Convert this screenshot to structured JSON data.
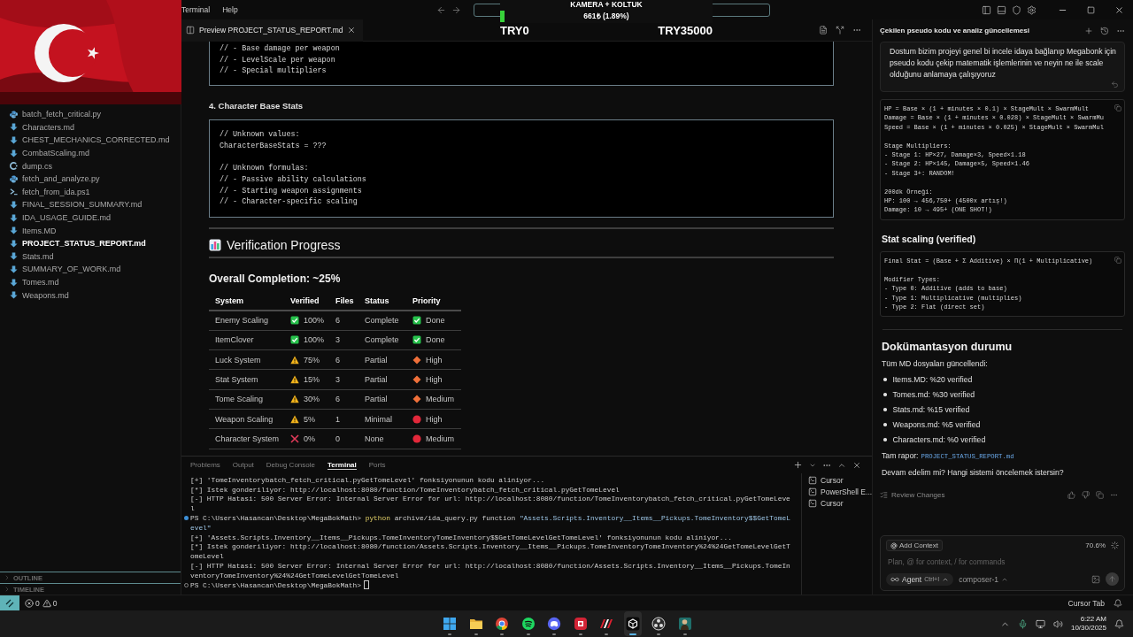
{
  "menu": {
    "items": [
      "Terminal",
      "Help"
    ]
  },
  "overlay": {
    "title": "KAMERA + KOLTUK",
    "reading": "661₺ (1.89%)",
    "level": 0.0189,
    "min_label": "TRY0",
    "max_label": "TRY35000"
  },
  "sidebar": {
    "files": [
      {
        "name": "batch_fetch_critical.py",
        "kind": "python",
        "selected": false
      },
      {
        "name": "Characters.md",
        "kind": "markdown",
        "selected": false
      },
      {
        "name": "CHEST_MECHANICS_CORRECTED.md",
        "kind": "markdown",
        "selected": false
      },
      {
        "name": "CombatScaling.md",
        "kind": "markdown",
        "selected": false
      },
      {
        "name": "dump.cs",
        "kind": "csharp",
        "selected": false
      },
      {
        "name": "fetch_and_analyze.py",
        "kind": "python",
        "selected": false
      },
      {
        "name": "fetch_from_ida.ps1",
        "kind": "powershell",
        "selected": false
      },
      {
        "name": "FINAL_SESSION_SUMMARY.md",
        "kind": "markdown",
        "selected": false
      },
      {
        "name": "IDA_USAGE_GUIDE.md",
        "kind": "markdown",
        "selected": false
      },
      {
        "name": "Items.MD",
        "kind": "markdown",
        "selected": false
      },
      {
        "name": "PROJECT_STATUS_REPORT.md",
        "kind": "markdown",
        "selected": true
      },
      {
        "name": "Stats.md",
        "kind": "markdown",
        "selected": false
      },
      {
        "name": "SUMMARY_OF_WORK.md",
        "kind": "markdown",
        "selected": false
      },
      {
        "name": "Tomes.md",
        "kind": "markdown",
        "selected": false
      },
      {
        "name": "Weapons.md",
        "kind": "markdown",
        "selected": false
      }
    ],
    "sections": [
      "OUTLINE",
      "TIMELINE"
    ]
  },
  "editor": {
    "tab": "Preview PROJECT_STATUS_REPORT.md",
    "code_top": [
      "// - Base damage per weapon",
      "// - LevelScale per weapon",
      "// - Special multipliers"
    ],
    "heading_4": "4. Character Base Stats",
    "code_2": [
      [
        "// Unknown values:",
        "CharacterBaseStats = ???"
      ],
      [
        "// Unknown formulas:",
        "// - Passive ability calculations",
        "// - Starting weapon assignments",
        "// - Character-specific scaling"
      ]
    ],
    "section_title": "Verification Progress",
    "overall": "Overall Completion: ~25%",
    "table": {
      "columns": [
        "System",
        "Verified",
        "Files",
        "Status",
        "Priority"
      ],
      "rows": [
        {
          "system": "Enemy Scaling",
          "verified": {
            "kind": "check",
            "text": "100%"
          },
          "files": "6",
          "status": "Complete",
          "priority": {
            "kind": "check",
            "text": "Done"
          }
        },
        {
          "system": "ItemClover",
          "verified": {
            "kind": "check",
            "text": "100%"
          },
          "files": "3",
          "status": "Complete",
          "priority": {
            "kind": "check",
            "text": "Done"
          }
        },
        {
          "system": "Luck System",
          "verified": {
            "kind": "warning",
            "text": "75%"
          },
          "files": "6",
          "status": "Partial",
          "priority": {
            "kind": "diamond",
            "text": "High"
          }
        },
        {
          "system": "Stat System",
          "verified": {
            "kind": "warning",
            "text": "15%"
          },
          "files": "3",
          "status": "Partial",
          "priority": {
            "kind": "diamond",
            "text": "High"
          }
        },
        {
          "system": "Tome Scaling",
          "verified": {
            "kind": "warning",
            "text": "30%"
          },
          "files": "6",
          "status": "Partial",
          "priority": {
            "kind": "diamond",
            "text": "Medium"
          }
        },
        {
          "system": "Weapon Scaling",
          "verified": {
            "kind": "warning",
            "text": "5%"
          },
          "files": "1",
          "status": "Minimal",
          "priority": {
            "kind": "dot",
            "text": "High"
          }
        },
        {
          "system": "Character System",
          "verified": {
            "kind": "cross",
            "text": "0%"
          },
          "files": "0",
          "status": "None",
          "priority": {
            "kind": "dot",
            "text": "Medium"
          }
        }
      ]
    }
  },
  "terminal": {
    "tabs": [
      {
        "label": "Problems",
        "selected": false
      },
      {
        "label": "Output",
        "selected": false
      },
      {
        "label": "Debug Console",
        "selected": false
      },
      {
        "label": "Terminal",
        "selected": true
      },
      {
        "label": "Ports",
        "selected": false
      }
    ],
    "lines": [
      {
        "kind": "out",
        "text": "[+] 'TomeInventorybatch_fetch_critical.pyGetTomeLevel' fonksiyonunun kodu aliniyor..."
      },
      {
        "kind": "out",
        "text": "[*] Istek gonderiliyor: http://localhost:8080/function/TomeInventorybatch_fetch_critical.pyGetTomeLevel"
      },
      {
        "kind": "out",
        "text": "[-] HTTP Hatasi: 500 Server Error: Internal Server Error for url: http://localhost:8080/function/TomeInventorybatch_fetch_critical.pyGetTomeLeve"
      },
      {
        "kind": "out",
        "text": "l"
      },
      {
        "kind": "prompt",
        "succeeded": true,
        "prompt": "PS C:\\Users\\Hasancan\\Desktop\\MegaBokMath>",
        "command": "python",
        "args": "archive/ida_query.py function",
        "string": "\"Assets.Scripts.Inventory__Items__Pickups.TomeInventory$$GetTomeL"
      },
      {
        "kind": "string",
        "text": "evel\""
      },
      {
        "kind": "out",
        "text": "[+] 'Assets.Scripts.Inventory__Items__Pickups.TomeInventoryTomeInventory$$GetTomeLevelGetTomeLevel' fonksiyonunun kodu aliniyor..."
      },
      {
        "kind": "out",
        "text": "[*] Istek gonderiliyor: http://localhost:8080/function/Assets.Scripts.Inventory__Items__Pickups.TomeInventoryTomeInventory%24%24GetTomeLevelGetT"
      },
      {
        "kind": "out",
        "text": "omeLevel"
      },
      {
        "kind": "out",
        "text": "[-] HTTP Hatasi: 500 Server Error: Internal Server Error for url: http://localhost:8080/function/Assets.Scripts.Inventory__Items__Pickups.TomeIn"
      },
      {
        "kind": "out",
        "text": "ventoryTomeInventory%24%24GetTomeLevelGetTomeLevel"
      },
      {
        "kind": "prompt",
        "succeeded": false,
        "prompt": "PS C:\\Users\\Hasancan\\Desktop\\MegaBokMath>",
        "cursor": true
      }
    ],
    "sessions": [
      "Cursor",
      "PowerShell E...",
      "Cursor"
    ]
  },
  "chat": {
    "title": "Çekilen pseudo kodu ve analiz güncellemesi",
    "message": "Dostum bizim projeyi genel bi incele idaya bağlanıp Megabonk için pseudo kodu çekip matematik işlemlerinin ve neyin ne ile scale olduğunu anlamaya çalışıyoruz",
    "code_1": [
      [
        "HP = Base × (1 + minutes × 0.1) × StageMult × SwarmMult",
        "Damage = Base × (1 + minutes × 0.028) × StageMult × SwarmMu",
        "Speed = Base × (1 + minutes × 0.025) × StageMult × SwarmMul"
      ],
      [
        "Stage Multipliers:",
        "- Stage 1: HP×27, Damage×3, Speed×1.18",
        "- Stage 2: HP×145, Damage×5, Speed×1.46",
        "- Stage 3+: RANDOM!"
      ],
      [
        "200dk Örneği:",
        "HP: 100 → 456,750+ (4500x artış!)",
        "Damage: 10 → 495+ (ONE SHOT!)"
      ]
    ],
    "heading_1": "Stat scaling (verified)",
    "code_2": [
      [
        "Final Stat = (Base + Σ Additive) × Π(1 + Multiplicative)"
      ],
      [
        "Modifier Types:",
        "- Type 0: Additive (adds to base)",
        "- Type 1: Multiplicative (multiplies)",
        "- Type 2: Flat (direct set)"
      ]
    ],
    "heading_2": "Dokümantasyon durumu",
    "intro": "Tüm MD dosyaları güncellendi:",
    "bullets": [
      "Items.MD: %20 verified",
      "Tomes.md: %30 verified",
      "Stats.md: %15 verified",
      "Weapons.md: %5 verified",
      "Characters.md: %0 verified"
    ],
    "report_label": "Tam rapor:",
    "report_link": "PROJECT_STATUS_REPORT.md",
    "question": "Devam edelim mi? Hangi sistemi öncelemek istersin?",
    "review": "Review Changes",
    "add_context": "Add Context",
    "context_usage": "70.6%",
    "placeholder": "Plan, @ for context, / for commands",
    "mode": "Agent",
    "mode_shortcut": "Ctrl+I",
    "model": "composer-1"
  },
  "status_bar": {
    "errors": "0",
    "warnings": "0",
    "right": "Cursor Tab"
  },
  "taskbar": {
    "apps": [
      {
        "kind": "start",
        "active": false
      },
      {
        "kind": "folder",
        "active": false
      },
      {
        "kind": "browser",
        "active": false
      },
      {
        "kind": "music",
        "active": false
      },
      {
        "kind": "chat",
        "active": false
      },
      {
        "kind": "store",
        "active": false
      },
      {
        "kind": "stripes",
        "active": false
      },
      {
        "kind": "cube",
        "active": true
      },
      {
        "kind": "record",
        "active": false
      },
      {
        "kind": "portrait",
        "active": false
      }
    ],
    "time": "6:22 AM",
    "date": "10/30/2025"
  }
}
